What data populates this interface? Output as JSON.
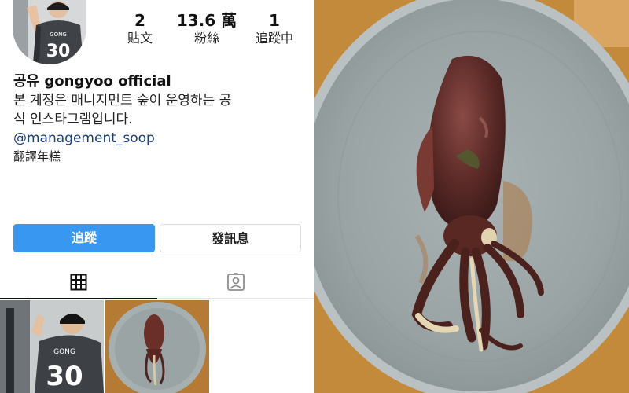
{
  "profile": {
    "stats": [
      {
        "value": "2",
        "label": "貼文"
      },
      {
        "value": "13.6 萬",
        "label": "粉絲"
      },
      {
        "value": "1",
        "label": "追蹤中"
      }
    ],
    "name": "공유 gongyoo official",
    "bio_line1": "본 계정은 매니지먼트 숲이 운영하는 공",
    "bio_line2": "식 인스타그램입니다.",
    "mention": "@management_soop",
    "translate": "翻譯年糕",
    "jersey_name": "GONG",
    "jersey_number": "30"
  },
  "actions": {
    "follow_label": "追蹤",
    "message_label": "發訊息"
  },
  "tabs": [
    {
      "name": "grid",
      "icon": "grid-icon",
      "active": true
    },
    {
      "name": "tagged",
      "icon": "tagged-icon",
      "active": false
    }
  ],
  "posts": [
    {
      "alt": "gongyoo-jersey-photo"
    },
    {
      "alt": "squid-plate-photo"
    }
  ],
  "colors": {
    "follow_button": "#3897f0",
    "mention_text": "#1b3f7a",
    "plate": "#9aa5a6",
    "table": "#c58a3a"
  }
}
